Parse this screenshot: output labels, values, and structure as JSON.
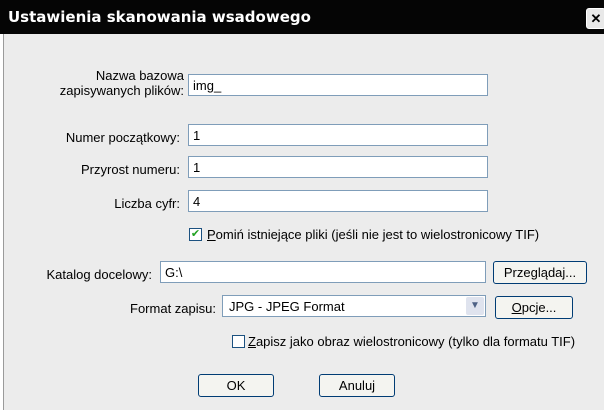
{
  "window": {
    "title": "Ustawienia skanowania wsadowego",
    "close_glyph": "✕"
  },
  "form": {
    "base_name": {
      "label": "Nazwa bazowa zapisywanych plików:",
      "value": "img_"
    },
    "start_number": {
      "label": "Numer początkowy:",
      "value": "1"
    },
    "increment": {
      "label": "Przyrost numeru:",
      "value": "1"
    },
    "digits": {
      "label": "Liczba cyfr:",
      "value": "4"
    },
    "skip_existing": {
      "checked": true,
      "label_accel": "P",
      "label_rest": "omiń istniejące pliki (jeśli nie jest to wielostronicowy TIF)"
    },
    "target_dir": {
      "label": "Katalog docelowy:",
      "value": "G:\\"
    },
    "browse_button": "Przeglądaj...",
    "format": {
      "label": "Format zapisu:",
      "selected": "JPG - JPEG Format"
    },
    "options_button": {
      "accel": "O",
      "rest": "pcje..."
    },
    "multipage": {
      "checked": false,
      "label_accel": "Z",
      "label_rest": "apisz jako obraz wielostronicowy (tylko dla formatu TIF)"
    }
  },
  "buttons": {
    "ok": "OK",
    "cancel": "Anuluj"
  },
  "icons": {
    "checkmark": "✔",
    "dropdown_arrow": "▼"
  }
}
